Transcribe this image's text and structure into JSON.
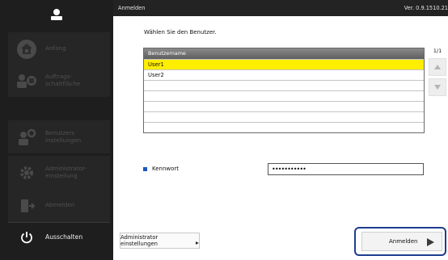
{
  "header": {
    "title": "Anmelden",
    "version": "Ver. 0.9.1510.21"
  },
  "sidebar": {
    "items": [
      {
        "label": "Anfang",
        "icon": "home-icon"
      },
      {
        "label": "Auftrags-\nschaltfläche",
        "icon": "job-button-icon"
      },
      {
        "label": "Benutzers instellungen",
        "icon": "user-settings-icon"
      },
      {
        "label": "Administrator-\neinstellung",
        "icon": "admin-gear-icon"
      },
      {
        "label": "Abmelden",
        "icon": "logout-door-icon"
      }
    ],
    "power_label": "Ausschalten"
  },
  "main": {
    "prompt": "Wählen Sie den Benutzer.",
    "table": {
      "header": "Benutzername",
      "rows": [
        "User1",
        "User2",
        "",
        "",
        "",
        "",
        ""
      ],
      "selected": "User1"
    },
    "page_indicator": "1/1",
    "password": {
      "label": "Kennwort",
      "value": "•••••••••••"
    }
  },
  "footer": {
    "admin_button": "Administrator einstellungen",
    "login_button": "Anmelden"
  },
  "colors": {
    "sidebar_bg": "#1e1e1e",
    "header_bg": "#232323",
    "selected_row": "#ffee00",
    "focus_ring": "#1f3d8f",
    "password_marker": "#1a56c4"
  }
}
